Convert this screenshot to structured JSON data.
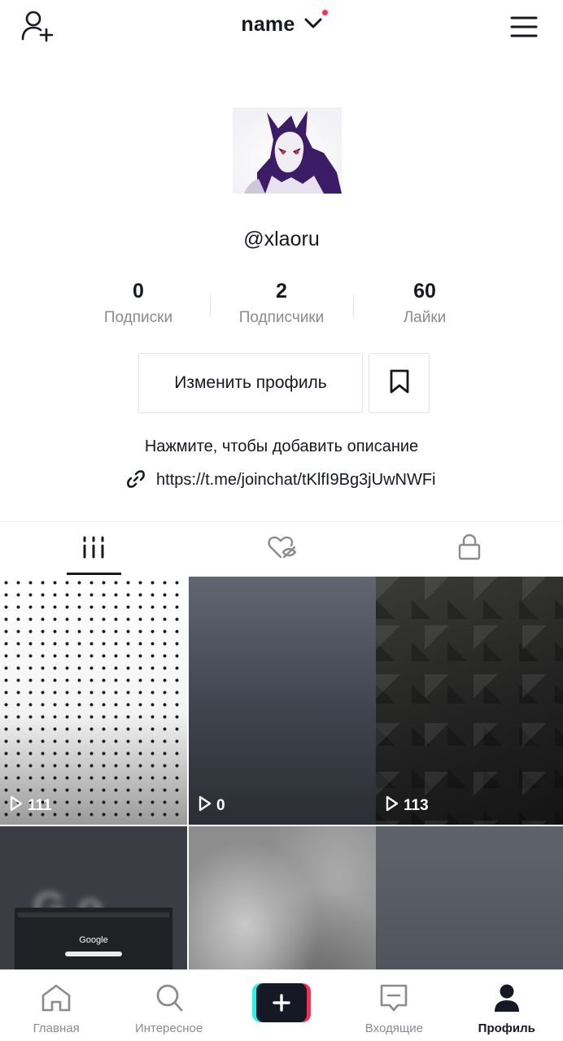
{
  "header": {
    "title": "name",
    "icons": {
      "left": "add-user-icon",
      "title": "chevron-down-icon",
      "right": "menu-icon"
    },
    "notification_dot_color": "#fe2c55"
  },
  "profile": {
    "username": "@xlaoru",
    "stats": [
      {
        "value": "0",
        "label": "Подписки"
      },
      {
        "value": "2",
        "label": "Подписчики"
      },
      {
        "value": "60",
        "label": "Лайки"
      }
    ],
    "edit_button_label": "Изменить профиль",
    "bookmark_icon": "bookmark-icon",
    "bio_placeholder": "Нажмите, чтобы добавить описание",
    "link": "https://t.me/joinchat/tKlfI9Bg3jUwNWFi"
  },
  "tabs": [
    {
      "icon": "grid-icon",
      "active": true
    },
    {
      "icon": "liked-hidden-icon",
      "active": false
    },
    {
      "icon": "lock-icon",
      "active": false
    }
  ],
  "videos": [
    {
      "views": "111"
    },
    {
      "views": "0"
    },
    {
      "views": "113"
    },
    {
      "views": ""
    },
    {
      "views": ""
    },
    {
      "views": ""
    }
  ],
  "thumb_text": {
    "google": "Google"
  },
  "bottom_nav": [
    {
      "label": "Главная",
      "icon": "home-icon"
    },
    {
      "label": "Интересное",
      "icon": "search-icon"
    },
    {
      "label": "",
      "icon": "plus-icon"
    },
    {
      "label": "Входящие",
      "icon": "inbox-icon"
    },
    {
      "label": "Профиль",
      "icon": "profile-icon",
      "active": true
    }
  ],
  "colors": {
    "text": "#161823",
    "secondary": "#8a8b91",
    "accent_cyan": "#25f4ee",
    "accent_red": "#fe2c55"
  }
}
